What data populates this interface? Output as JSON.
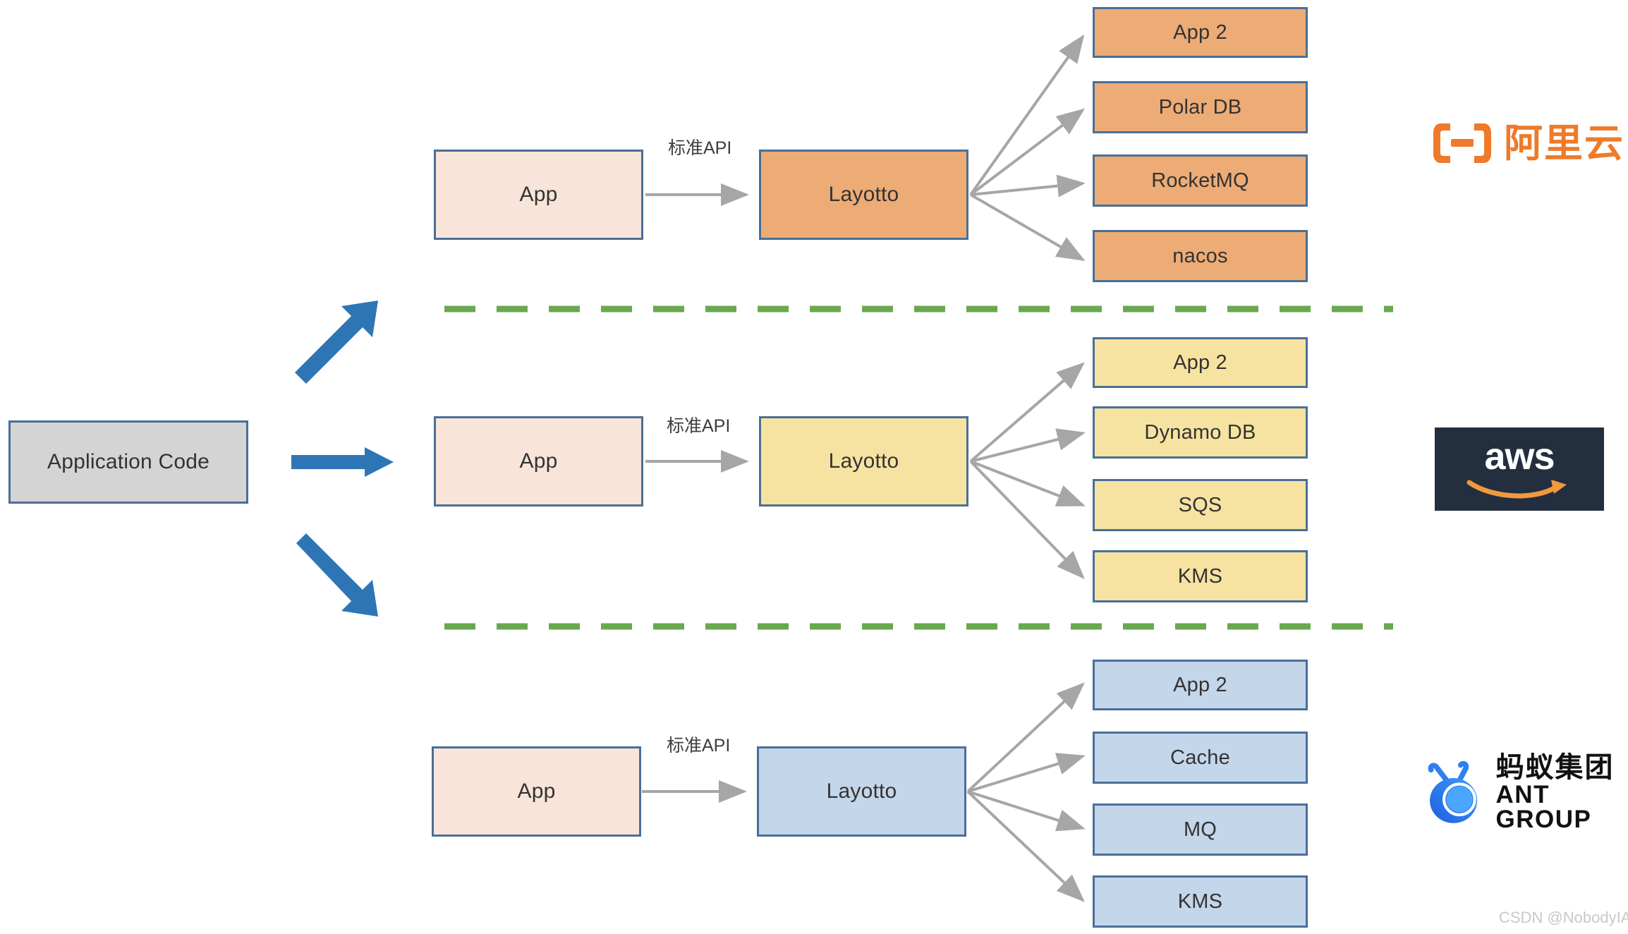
{
  "diagram": {
    "source_node": {
      "label": "Application Code"
    },
    "rows": [
      {
        "id": "alicloud",
        "app": {
          "label": "App"
        },
        "api_label": "标准API",
        "runtime": {
          "label": "Layotto"
        },
        "services": [
          {
            "label": "App 2"
          },
          {
            "label": "Polar DB"
          },
          {
            "label": "RocketMQ"
          },
          {
            "label": "nacos"
          }
        ],
        "provider_logo": {
          "name": "alibaba-cloud-logo",
          "text": "阿里云"
        }
      },
      {
        "id": "aws",
        "app": {
          "label": "App"
        },
        "api_label": "标准API",
        "runtime": {
          "label": "Layotto"
        },
        "services": [
          {
            "label": "App 2"
          },
          {
            "label": "Dynamo DB"
          },
          {
            "label": "SQS"
          },
          {
            "label": "KMS"
          }
        ],
        "provider_logo": {
          "name": "aws-logo",
          "text": "aws"
        }
      },
      {
        "id": "antgroup",
        "app": {
          "label": "App"
        },
        "api_label": "标准API",
        "runtime": {
          "label": "Layotto"
        },
        "services": [
          {
            "label": "App 2"
          },
          {
            "label": "Cache"
          },
          {
            "label": "MQ"
          },
          {
            "label": "KMS"
          }
        ],
        "provider_logo": {
          "name": "ant-group-logo",
          "text_cn": "蚂蚁集团",
          "text_en": "ANT GROUP"
        }
      }
    ],
    "colors": {
      "box_border": "#4a6f96",
      "app_fill": "#f8e4d9",
      "alicloud_fill": "#edab76",
      "aws_fill": "#f7e3a1",
      "ant_fill": "#c3d6ea",
      "source_fill": "#d4d4d4",
      "big_arrow": "#2e75b6",
      "thin_arrow": "#a6a6a6",
      "divider": "#6aa84f",
      "alibaba_orange": "#ef7a29",
      "aws_navy": "#232f3e",
      "aws_smile": "#ef9a3d",
      "ant_blue": "#2a7ef5"
    }
  },
  "watermark": {
    "text": "CSDN @NobodyIAm"
  }
}
